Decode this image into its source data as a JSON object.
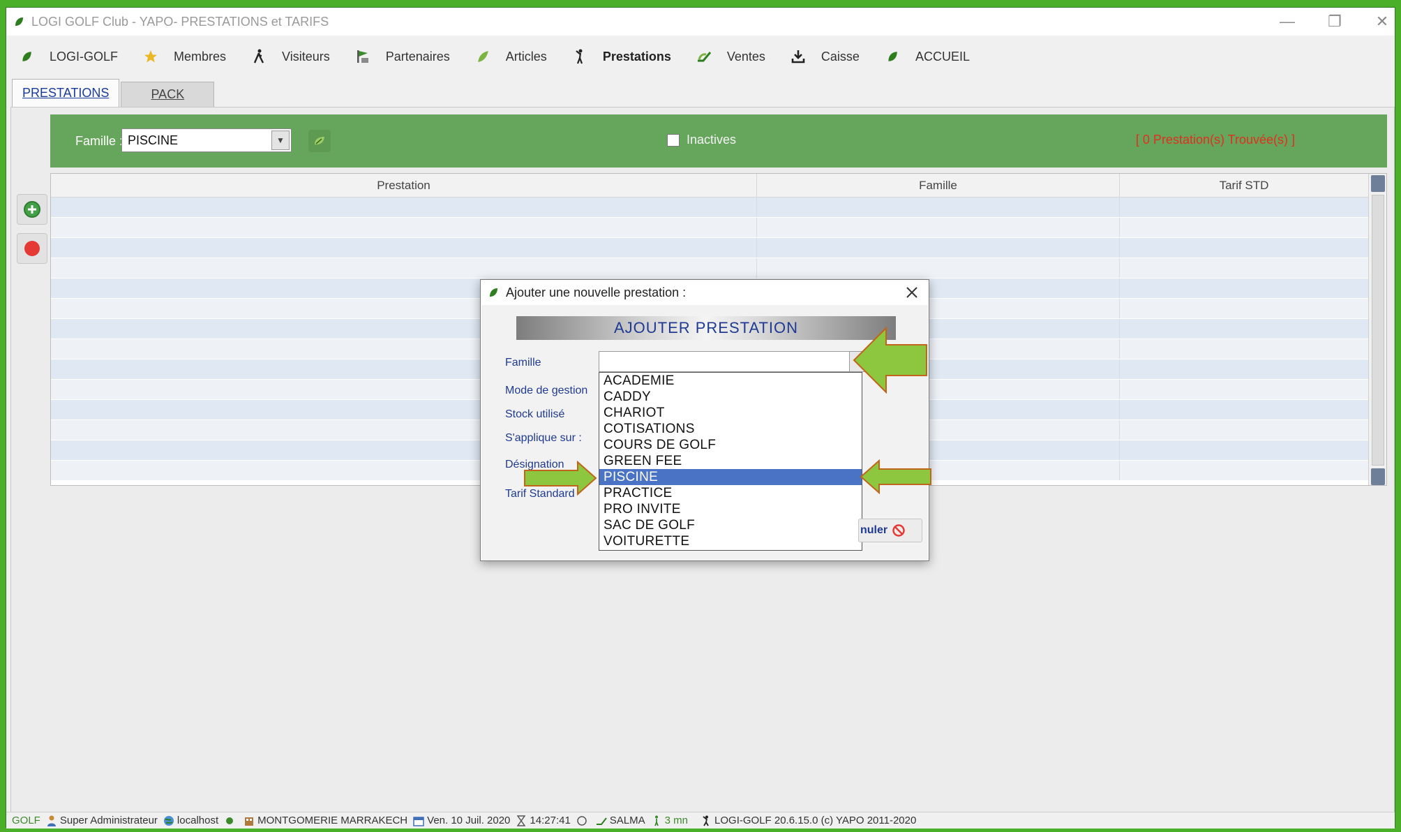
{
  "window": {
    "title": "LOGI GOLF Club - YAPO- PRESTATIONS et TARIFS",
    "minimize": "—",
    "maximize": "❐",
    "close": "✕"
  },
  "menu": [
    {
      "label": "LOGI-GOLF",
      "icon": "leaf-icon"
    },
    {
      "label": "Membres",
      "icon": "star-icon"
    },
    {
      "label": "Visiteurs",
      "icon": "walker-icon"
    },
    {
      "label": "Partenaires",
      "icon": "flag-icon"
    },
    {
      "label": "Articles",
      "icon": "leaf-icon"
    },
    {
      "label": "Prestations",
      "icon": "golfer-icon"
    },
    {
      "label": "Ventes",
      "icon": "ventes-icon"
    },
    {
      "label": "Caisse",
      "icon": "download-icon"
    },
    {
      "label": "ACCUEIL",
      "icon": "leaf-icon"
    }
  ],
  "tabs": [
    {
      "label": "PRESTATIONS",
      "active": true
    },
    {
      "label": "PACK",
      "active": false
    }
  ],
  "filter": {
    "famille_label": "Famille :",
    "famille_value": "PISCINE",
    "inactives_label": "Inactives",
    "count_text": "[ 0 Prestation(s) Trouvée(s) ]"
  },
  "grid": {
    "columns": [
      "Prestation",
      "Famille",
      "Tarif STD"
    ],
    "rows": []
  },
  "modal": {
    "title": "Ajouter une nouvelle prestation :",
    "heading": "AJOUTER PRESTATION",
    "labels": {
      "famille": "Famille",
      "mode_gestion": "Mode de gestion",
      "stock": "Stock utilisé",
      "applique": "S'applique sur :",
      "designation": "Désignation",
      "tarif": "Tarif Standard"
    },
    "famille_value": "",
    "options": [
      "ACADEMIE",
      "CADDY",
      "CHARIOT",
      "COTISATIONS",
      "COURS DE GOLF",
      "GREEN FEE",
      "PISCINE",
      "PRACTICE",
      "PRO INVITE",
      "SAC DE GOLF",
      "VOITURETTE"
    ],
    "selected_option": "PISCINE",
    "annuler_label": "nuler"
  },
  "status": {
    "app": "GOLF",
    "user": "Super Administrateur",
    "server": "localhost",
    "club": "MONTGOMERIE MARRAKECH",
    "date": "Ven. 10 Juil. 2020",
    "time": "14:27:41",
    "name": "SALMA",
    "duration": "3 mn",
    "version": "LOGI-GOLF 20.6.15.0  (c) YAPO 2011-2020"
  },
  "colors": {
    "frame_green": "#4caf2a",
    "filter_green": "#66a55c",
    "link_blue": "#1f3a93",
    "selection_blue": "#4a73c5",
    "alert_red": "#e0301e",
    "arrow_green": "#8dc63f"
  }
}
